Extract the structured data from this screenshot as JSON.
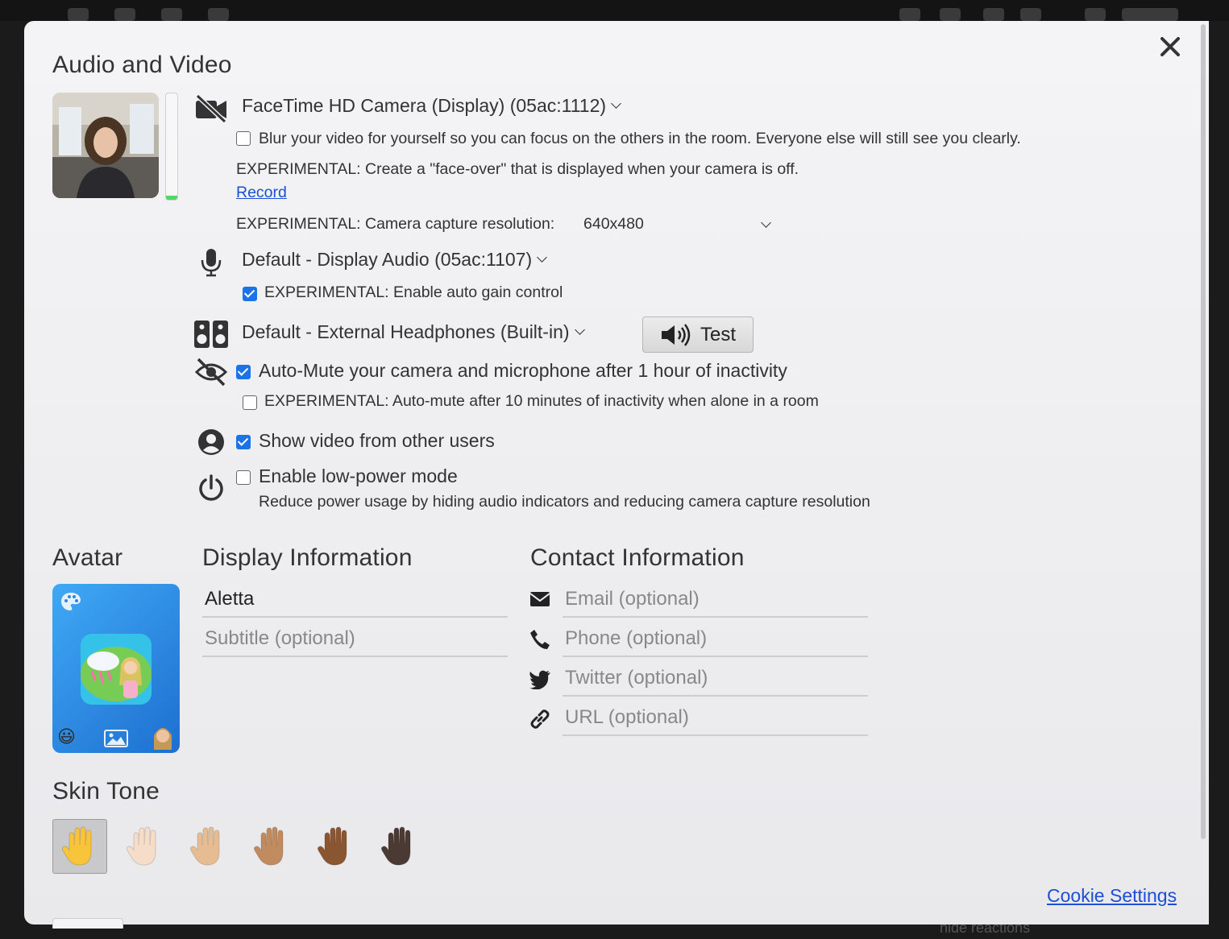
{
  "modal_title": "Audio and Video",
  "camera": {
    "device_label": "FaceTime HD Camera (Display) (05ac:1112)",
    "blur_label": "Blur your video for yourself so you can focus on the others in the room. Everyone else will still see you clearly.",
    "blur_checked": false,
    "faceover_label": "EXPERIMENTAL: Create a \"face-over\" that is displayed when your camera is off.",
    "record_link": "Record",
    "resolution_label": "EXPERIMENTAL: Camera capture resolution:",
    "resolution_value": "640x480"
  },
  "audio_level": 0.04,
  "microphone": {
    "device_label": "Default - Display Audio (05ac:1107)",
    "agc_label": "EXPERIMENTAL: Enable auto gain control",
    "agc_checked": true
  },
  "speaker": {
    "device_label": "Default - External Headphones (Built-in)",
    "test_label": "Test"
  },
  "automute": {
    "label": "Auto-Mute your camera and microphone after 1 hour of inactivity",
    "checked": true,
    "alone_label": "EXPERIMENTAL: Auto-mute after 10 minutes of inactivity when alone in a room",
    "alone_checked": false
  },
  "show_video": {
    "label": "Show video from other users",
    "checked": true
  },
  "low_power": {
    "label": "Enable low-power mode",
    "checked": false,
    "description": "Reduce power usage by hiding audio indicators and reducing camera capture resolution"
  },
  "avatar": {
    "title": "Avatar"
  },
  "display_info": {
    "title": "Display Information",
    "name_value": "Aletta",
    "subtitle_placeholder": "Subtitle (optional)"
  },
  "contact_info": {
    "title": "Contact Information",
    "email_placeholder": "Email (optional)",
    "phone_placeholder": "Phone (optional)",
    "twitter_placeholder": "Twitter (optional)",
    "url_placeholder": "URL (optional)"
  },
  "skin_tone": {
    "title": "Skin Tone",
    "selected_index": 0,
    "colors": [
      "#f8c43a",
      "#f6ddc9",
      "#e6bd93",
      "#c08b5f",
      "#8a5632",
      "#4a3a33"
    ]
  },
  "cookie_link": "Cookie Settings",
  "background_hint": "hide reactions",
  "accent_color": "#1a73e8"
}
